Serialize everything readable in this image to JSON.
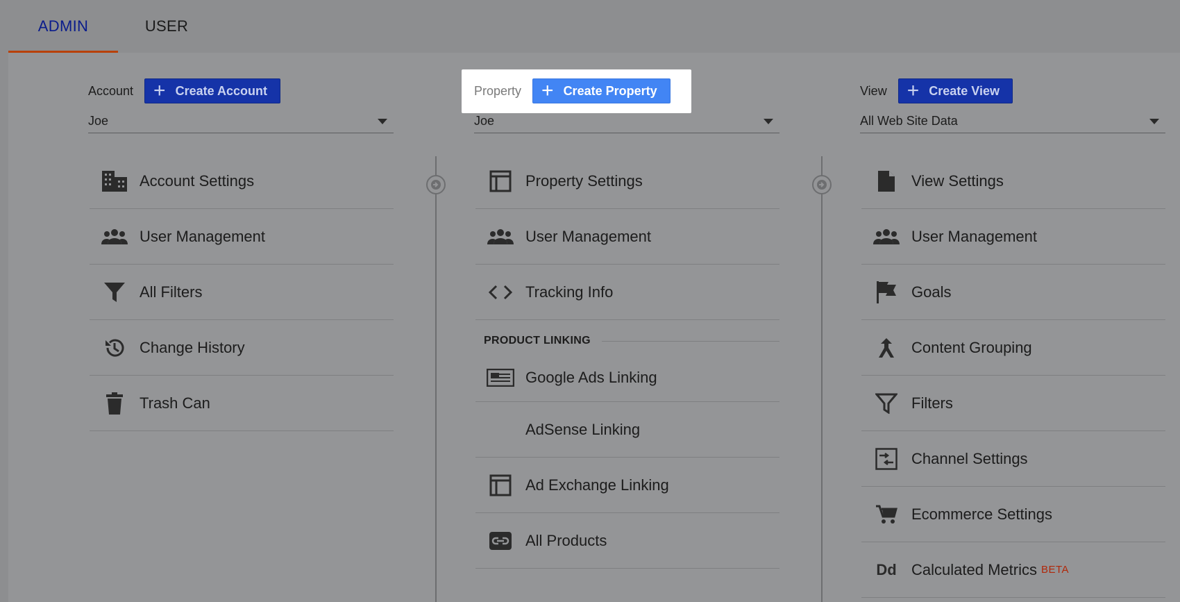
{
  "tabs": {
    "admin": "ADMIN",
    "user": "USER"
  },
  "account": {
    "label": "Account",
    "create_label": "Create Account",
    "selected": "Joe",
    "items": [
      {
        "icon": "building-icon",
        "label": "Account Settings"
      },
      {
        "icon": "people-icon",
        "label": "User Management"
      },
      {
        "icon": "filter-icon",
        "label": "All Filters"
      },
      {
        "icon": "history-icon",
        "label": "Change History"
      },
      {
        "icon": "trash-icon",
        "label": "Trash Can"
      }
    ]
  },
  "property": {
    "label": "Property",
    "create_label": "Create Property",
    "selected": "Joe",
    "items": [
      {
        "icon": "layout-icon",
        "label": "Property Settings"
      },
      {
        "icon": "people-icon",
        "label": "User Management"
      },
      {
        "icon": "code-icon",
        "label": "Tracking Info"
      }
    ],
    "section_title": "PRODUCT LINKING",
    "linking_items": [
      {
        "icon": "ads-icon",
        "label": "Google Ads Linking"
      },
      {
        "icon": "",
        "label": "AdSense Linking"
      },
      {
        "icon": "layout-icon",
        "label": "Ad Exchange Linking"
      },
      {
        "icon": "link-icon",
        "label": "All Products"
      }
    ]
  },
  "view": {
    "label": "View",
    "create_label": "Create View",
    "selected": "All Web Site Data",
    "items": [
      {
        "icon": "document-icon",
        "label": "View Settings"
      },
      {
        "icon": "people-icon",
        "label": "User Management"
      },
      {
        "icon": "flag-icon",
        "label": "Goals"
      },
      {
        "icon": "merge-icon",
        "label": "Content Grouping"
      },
      {
        "icon": "filter-icon",
        "label": "Filters"
      },
      {
        "icon": "channel-icon",
        "label": "Channel Settings"
      },
      {
        "icon": "cart-icon",
        "label": "Ecommerce Settings"
      },
      {
        "icon": "dd-icon",
        "label": "Calculated Metrics",
        "badge": "BETA",
        "icon_text": "Dd"
      }
    ]
  },
  "colors": {
    "tab_active": "#0a1c8c",
    "tab_underline": "#b8410a",
    "primary_button": "#4285f4",
    "dimmed_button": "#1533a8",
    "beta": "#b0280a"
  }
}
